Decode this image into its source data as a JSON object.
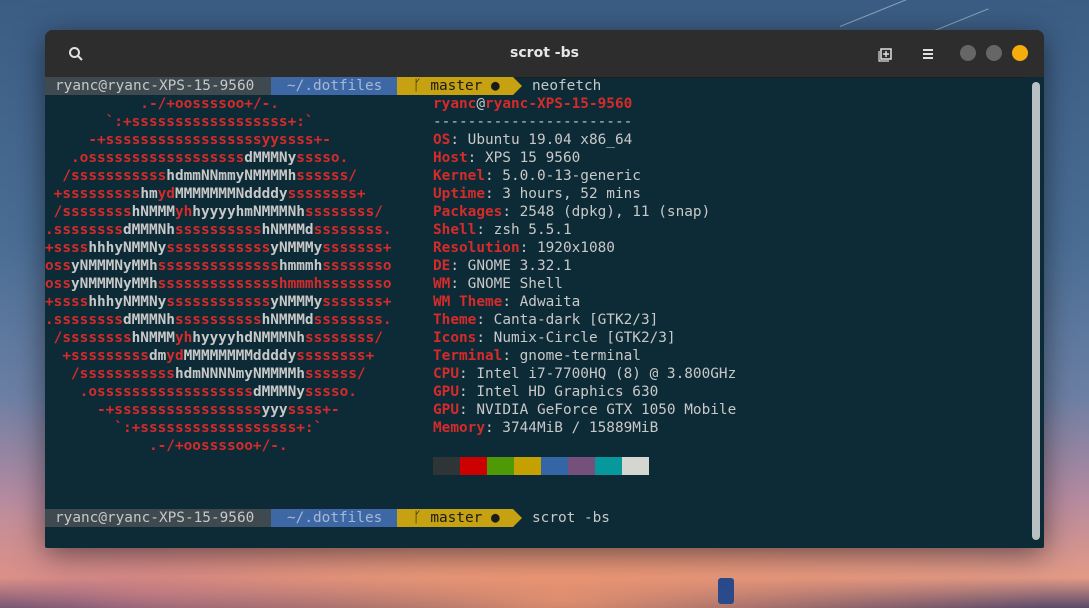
{
  "window": {
    "title": "scrot -bs",
    "icons": [
      "search-icon",
      "new-tab-icon",
      "hamburger-menu-icon"
    ],
    "buttons": [
      {
        "name": "minimize",
        "color": "#666666"
      },
      {
        "name": "maximize",
        "color": "#666666"
      },
      {
        "name": "close",
        "color": "#f5ad0c"
      }
    ]
  },
  "prompt1": {
    "user": "ryanc@ryanc-XPS-15-9560",
    "path": "~/.dotfiles",
    "branch_icon": "ᚴ",
    "branch": "master ●",
    "command": "neofetch"
  },
  "prompt2": {
    "user": "ryanc@ryanc-XPS-15-9560",
    "path": "~/.dotfiles",
    "branch_icon": "ᚴ",
    "branch": "master ●",
    "command": "scrot -bs"
  },
  "logo_lines": [
    [
      [
        "r",
        "           .-/+oossssoo+/-."
      ]
    ],
    [
      [
        "r",
        "       `:+ssssssssssssssssss+:`"
      ]
    ],
    [
      [
        "r",
        "     -+ssssssssssssssssssyyssss+-"
      ]
    ],
    [
      [
        "r",
        "   .ossssssssssssssssss"
      ],
      [
        "w",
        "dMMMNy"
      ],
      [
        "r",
        "sssso."
      ]
    ],
    [
      [
        "r",
        "  /sssssssssss"
      ],
      [
        "w",
        "hdmmNNmmyNMMMMh"
      ],
      [
        "r",
        "ssssss/"
      ]
    ],
    [
      [
        "r",
        " +sssssssss"
      ],
      [
        "w",
        "hm"
      ],
      [
        "r",
        "yd"
      ],
      [
        "w",
        "MMMMMMMNddddy"
      ],
      [
        "r",
        "ssssssss+"
      ]
    ],
    [
      [
        "r",
        " /ssssssss"
      ],
      [
        "w",
        "hNMMM"
      ],
      [
        "r",
        "yh"
      ],
      [
        "w",
        "hyyyyhmNMMMNh"
      ],
      [
        "r",
        "ssssssss/"
      ]
    ],
    [
      [
        "r",
        ".ssssssss"
      ],
      [
        "w",
        "dMMMNh"
      ],
      [
        "r",
        "ssssssssss"
      ],
      [
        "w",
        "hNMMMd"
      ],
      [
        "r",
        "ssssssss."
      ]
    ],
    [
      [
        "r",
        "+ssss"
      ],
      [
        "w",
        "hhhyNMMNy"
      ],
      [
        "r",
        "ssssssssssss"
      ],
      [
        "w",
        "yNMMMy"
      ],
      [
        "r",
        "sssssss+"
      ]
    ],
    [
      [
        "r",
        "oss"
      ],
      [
        "w",
        "yNMMMNyMMh"
      ],
      [
        "r",
        "ssssssssssssss"
      ],
      [
        "w",
        "hmmmh"
      ],
      [
        "r",
        "ssssssso"
      ]
    ],
    [
      [
        "r",
        "oss"
      ],
      [
        "w",
        "yNMMMNyMMh"
      ],
      [
        "r",
        "sssssssssssssshmmmhssssssso"
      ]
    ],
    [
      [
        "r",
        "+ssss"
      ],
      [
        "w",
        "hhhyNMMNy"
      ],
      [
        "r",
        "ssssssssssss"
      ],
      [
        "w",
        "yNMMMy"
      ],
      [
        "r",
        "sssssss+"
      ]
    ],
    [
      [
        "r",
        ".ssssssss"
      ],
      [
        "w",
        "dMMMNh"
      ],
      [
        "r",
        "ssssssssss"
      ],
      [
        "w",
        "hNMMMd"
      ],
      [
        "r",
        "ssssssss."
      ]
    ],
    [
      [
        "r",
        " /ssssssss"
      ],
      [
        "w",
        "hNMMM"
      ],
      [
        "r",
        "yh"
      ],
      [
        "w",
        "hyyyyhdNMMMNh"
      ],
      [
        "r",
        "ssssssss/"
      ]
    ],
    [
      [
        "r",
        "  +sssssssss"
      ],
      [
        "w",
        "dm"
      ],
      [
        "r",
        "yd"
      ],
      [
        "w",
        "MMMMMMMMddddy"
      ],
      [
        "r",
        "ssssssss+"
      ]
    ],
    [
      [
        "r",
        "   /sssssssssss"
      ],
      [
        "w",
        "hdmNNNNmyNMMMMh"
      ],
      [
        "r",
        "ssssss/"
      ]
    ],
    [
      [
        "r",
        "    .ossssssssssssssssss"
      ],
      [
        "w",
        "dMMMNy"
      ],
      [
        "r",
        "sssso."
      ]
    ],
    [
      [
        "r",
        "      -+sssssssssssssssss"
      ],
      [
        "w",
        "yyy"
      ],
      [
        "r",
        "ssss+-"
      ]
    ],
    [
      [
        "r",
        "        `:+ssssssssssssssssss+:`"
      ]
    ],
    [
      [
        "r",
        "            .-/+oossssoo+/-."
      ]
    ]
  ],
  "info": {
    "header_user": "ryanc",
    "header_at": "@",
    "header_host": "ryanc-XPS-15-9560",
    "separator": "-----------------------",
    "rows": [
      {
        "key": "OS",
        "value": ": Ubuntu 19.04 x86_64"
      },
      {
        "key": "Host",
        "value": ": XPS 15 9560"
      },
      {
        "key": "Kernel",
        "value": ": 5.0.0-13-generic"
      },
      {
        "key": "Uptime",
        "value": ": 3 hours, 52 mins"
      },
      {
        "key": "Packages",
        "value": ": 2548 (dpkg), 11 (snap)"
      },
      {
        "key": "Shell",
        "value": ": zsh 5.5.1"
      },
      {
        "key": "Resolution",
        "value": ": 1920x1080"
      },
      {
        "key": "DE",
        "value": ": GNOME 3.32.1"
      },
      {
        "key": "WM",
        "value": ": GNOME Shell"
      },
      {
        "key": "WM Theme",
        "value": ": Adwaita"
      },
      {
        "key": "Theme",
        "value": ": Canta-dark [GTK2/3]"
      },
      {
        "key": "Icons",
        "value": ": Numix-Circle [GTK2/3]"
      },
      {
        "key": "Terminal",
        "value": ": gnome-terminal"
      },
      {
        "key": "CPU",
        "value": ": Intel i7-7700HQ (8) @ 3.800GHz"
      },
      {
        "key": "GPU",
        "value": ": Intel HD Graphics 630"
      },
      {
        "key": "GPU",
        "value": ": NVIDIA GeForce GTX 1050 Mobile"
      },
      {
        "key": "Memory",
        "value": ": 3744MiB / 15889MiB"
      }
    ]
  },
  "palette": [
    "#2f3436",
    "#cc0000",
    "#4e9a06",
    "#c4a000",
    "#3465a4",
    "#75507b",
    "#06989a",
    "#d3d7cf"
  ],
  "colors": {
    "prompt_user_bg": "#3f4a50",
    "prompt_path_bg": "#3d67a5",
    "prompt_git_bg": "#c6a212",
    "accent_red": "#d42b2b",
    "terminal_bg": "#0d2b36"
  }
}
